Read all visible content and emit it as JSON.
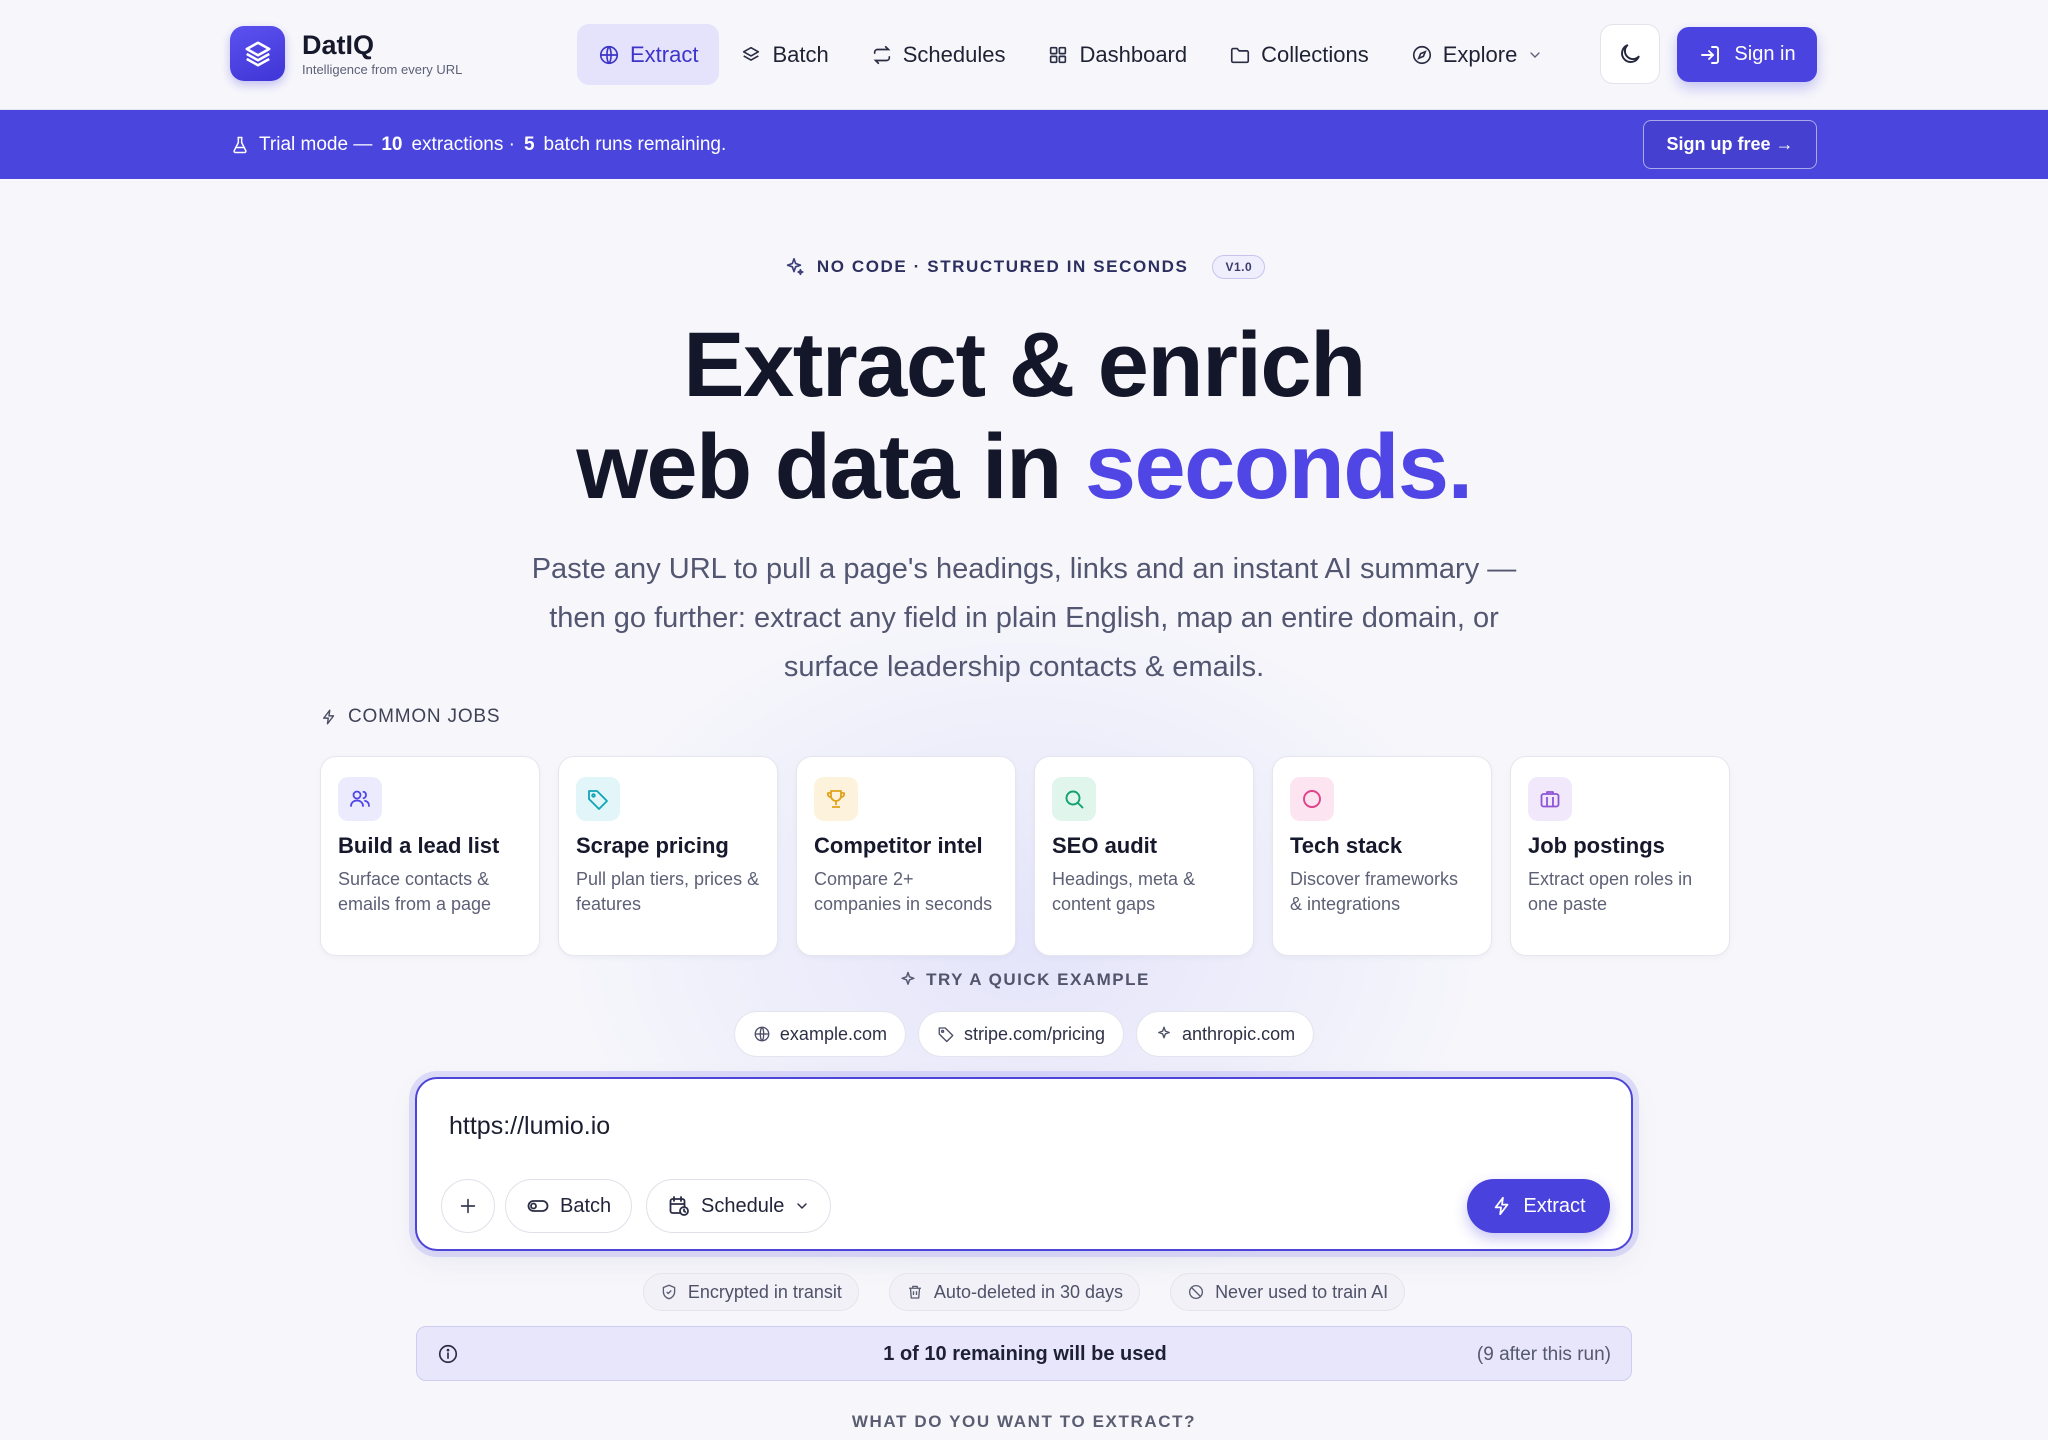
{
  "header": {
    "brand_name": "DatIQ",
    "brand_tagline": "Intelligence from every URL",
    "nav": [
      {
        "label": "Extract",
        "icon": "globe-icon",
        "active": true
      },
      {
        "label": "Batch",
        "icon": "layers-icon"
      },
      {
        "label": "Schedules",
        "icon": "repeat-icon"
      },
      {
        "label": "Dashboard",
        "icon": "grid-icon"
      },
      {
        "label": "Collections",
        "icon": "folder-icon"
      },
      {
        "label": "Explore",
        "icon": "compass-icon",
        "dropdown": true
      }
    ],
    "theme_toggle_icon": "moon-icon",
    "signin_label": "Sign in"
  },
  "banner": {
    "prefix": "Trial mode —",
    "extractions_count": "10",
    "extractions_label": "extractions ·",
    "batch_count": "5",
    "batch_label": "batch runs remaining.",
    "signup_label": "Sign up free →"
  },
  "hero": {
    "eyebrow": "NO CODE · STRUCTURED IN SECONDS",
    "version": "V1.0",
    "headline_line1": "Extract & enrich",
    "headline_line2_prefix": "web data in ",
    "headline_accent": "seconds.",
    "subtext": "Paste any URL to pull a page's headings, links and an instant AI summary — then go further: extract any field in plain English, map an entire domain, or surface leadership contacts & emails."
  },
  "common_jobs": {
    "label": "COMMON JOBS",
    "items": [
      {
        "title": "Build a lead list",
        "desc": "Surface contacts & emails from a page",
        "icon": "users-icon",
        "color": "#4f46e5",
        "bg": "#ecebfd"
      },
      {
        "title": "Scrape pricing",
        "desc": "Pull plan tiers, prices & features",
        "icon": "tag-icon",
        "color": "#0ea5b7",
        "bg": "#e2f6f9"
      },
      {
        "title": "Competitor intel",
        "desc": "Compare 2+ companies in seconds",
        "icon": "trophy-icon",
        "color": "#e0a21a",
        "bg": "#fdf3dd"
      },
      {
        "title": "SEO audit",
        "desc": "Headings, meta & content gaps",
        "icon": "search-icon",
        "color": "#12a26b",
        "bg": "#e0f5ec"
      },
      {
        "title": "Tech stack",
        "desc": "Discover frameworks & integrations",
        "icon": "circle-icon",
        "color": "#e0418b",
        "bg": "#fce5f0"
      },
      {
        "title": "Job postings",
        "desc": "Extract open roles in one paste",
        "icon": "briefcase-icon",
        "color": "#8e54d6",
        "bg": "#f1e9fb"
      }
    ]
  },
  "quick_examples": {
    "label": "TRY A QUICK EXAMPLE",
    "items": [
      {
        "label": "example.com",
        "icon": "globe-icon"
      },
      {
        "label": "stripe.com/pricing",
        "icon": "tag-icon"
      },
      {
        "label": "anthropic.com",
        "icon": "sparkle-icon"
      }
    ]
  },
  "url_box": {
    "value": "https://lumio.io",
    "batch_label": "Batch",
    "schedule_label": "Schedule",
    "extract_label": "Extract"
  },
  "trust": [
    {
      "label": "Encrypted in transit",
      "icon": "shield-icon"
    },
    {
      "label": "Auto-deleted in 30 days",
      "icon": "trash-icon"
    },
    {
      "label": "Never used to train AI",
      "icon": "ban-icon"
    }
  ],
  "usage": {
    "main": "1 of 10 remaining will be used",
    "after": "(9 after this run)"
  },
  "next_section_label": "WHAT DO YOU WANT TO EXTRACT?",
  "colors": {
    "accent": "#4f46e5",
    "banner": "#4a45dd"
  }
}
